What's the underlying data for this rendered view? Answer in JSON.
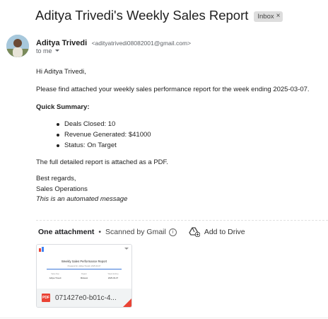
{
  "email": {
    "subject": "Aditya Trivedi's Weekly Sales Report",
    "label_badge": "Inbox",
    "label_close": "×",
    "sender_name": "Aditya Trivedi",
    "sender_email": "<adityatrivedi08082001@gmail.com>",
    "to_text": "to me",
    "greeting": "Hi Aditya Trivedi,",
    "intro": "Please find attached your weekly sales performance report for the week ending 2025-03-07.",
    "summary_heading": "Quick Summary:",
    "summary_items": [
      "Deals Closed: 10",
      "Revenue Generated: $41000",
      "Status: On Target"
    ],
    "attachment_note": "The full detailed report is attached as a PDF.",
    "signoff": "Best regards,",
    "signature": "Sales Operations",
    "automated_note": "This is an automated message"
  },
  "attachments": {
    "count_label": "One attachment",
    "scan_label": "Scanned by Gmail",
    "add_to_drive": "Add to Drive",
    "file": {
      "type_label": "PDF",
      "name": "071427e0-b01c-4...",
      "preview_title": "Weekly Sales Performance Report",
      "preview_subtitle": "Prepared for: Aditya Trivedi | 2025-03-07",
      "preview_columns": [
        {
          "label": "Sales Rep",
          "value": "Aditya Trivedi"
        },
        {
          "label": "Region",
          "value": "Midwest"
        },
        {
          "label": "Week Ending",
          "value": "2025-03-07"
        }
      ]
    }
  },
  "icons": {
    "avatar": "user-avatar",
    "to_dropdown": "chevron-down-icon",
    "info": "info-icon",
    "drive": "add-to-drive-icon",
    "pdf": "pdf-file-icon"
  }
}
